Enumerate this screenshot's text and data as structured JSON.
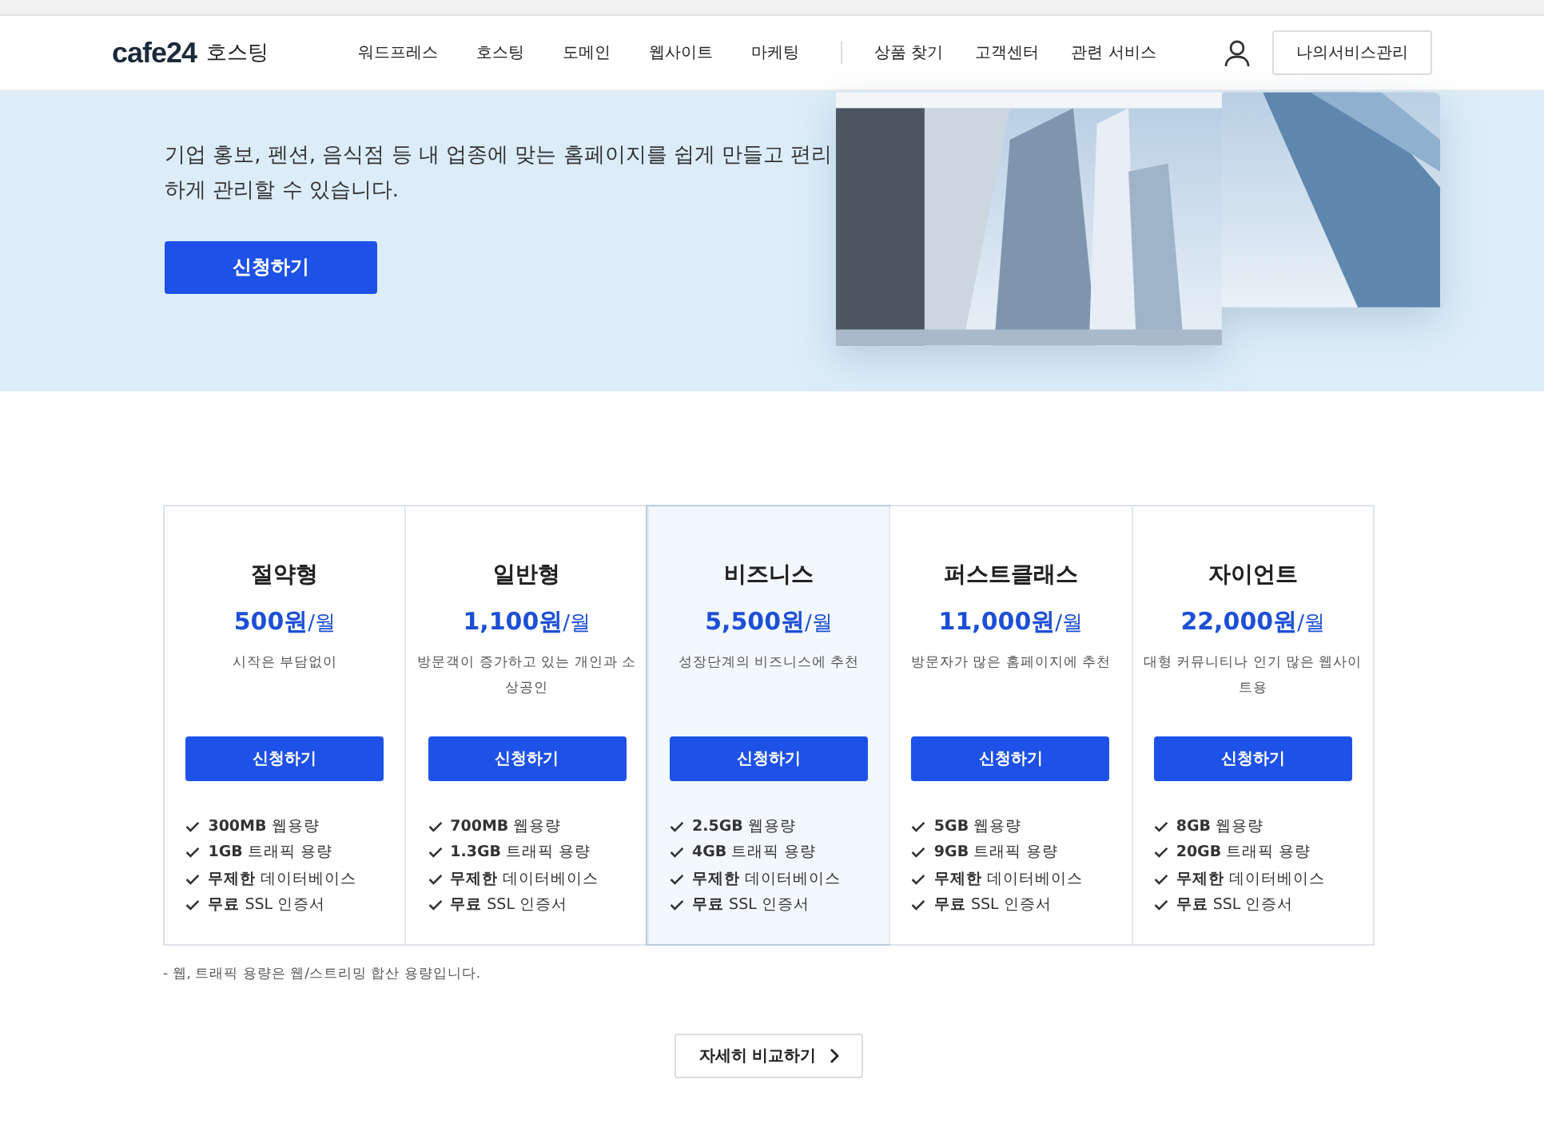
{
  "header": {
    "logo": "cafe24",
    "service": "호스팅",
    "nav": [
      "워드프레스",
      "호스팅",
      "도메인",
      "웹사이트",
      "마케팅"
    ],
    "nav_right": [
      "상품 찾기",
      "고객센터",
      "관련 서비스"
    ],
    "my_button": "나의서비스관리"
  },
  "hero": {
    "description": "기업 홍보, 펜션, 음식점 등 내 업종에 맞는 홈페이지를 쉽게 만들고 편리하게 관리할 수 있습니다.",
    "apply": "신청하기"
  },
  "plans": [
    {
      "name": "절약형",
      "price": "500원",
      "unit": "/월",
      "desc": "시작은 부담없이",
      "apply": "신청하기",
      "selected": false,
      "features": [
        "**300MB** 웹용량",
        "**1GB** 트래픽 용량",
        "**무제한** 데이터베이스",
        "**무료** SSL 인증서"
      ]
    },
    {
      "name": "일반형",
      "price": "1,100원",
      "unit": "/월",
      "desc": "방문객이 증가하고 있는 개인과 소상공인",
      "apply": "신청하기",
      "selected": false,
      "features": [
        "**700MB** 웹용량",
        "**1.3GB** 트래픽 용량",
        "**무제한** 데이터베이스",
        "**무료** SSL 인증서"
      ]
    },
    {
      "name": "비즈니스",
      "price": "5,500원",
      "unit": "/월",
      "desc": "성장단계의 비즈니스에 추천",
      "apply": "신청하기",
      "selected": true,
      "features": [
        "**2.5GB** 웹용량",
        "**4GB** 트래픽 용량",
        "**무제한** 데이터베이스",
        "**무료** SSL 인증서"
      ]
    },
    {
      "name": "퍼스트클래스",
      "price": "11,000원",
      "unit": "/월",
      "desc": "방문자가 많은 홈페이지에 추천",
      "apply": "신청하기",
      "selected": false,
      "features": [
        "**5GB** 웹용량",
        "**9GB** 트래픽 용량",
        "**무제한** 데이터베이스",
        "**무료** SSL 인증서"
      ]
    },
    {
      "name": "자이언트",
      "price": "22,000원",
      "unit": "/월",
      "desc": "대형 커뮤니티나 인기 많은 웹사이트용",
      "apply": "신청하기",
      "selected": false,
      "features": [
        "**8GB** 웹용량",
        "**20GB** 트래픽 용량",
        "**무제한** 데이터베이스",
        "**무료** SSL 인증서"
      ]
    }
  ],
  "note": "- 웹, 트래픽 용량은 웹/스트리밍 합산 용량입니다.",
  "compare_button": "자세히 비교하기"
}
